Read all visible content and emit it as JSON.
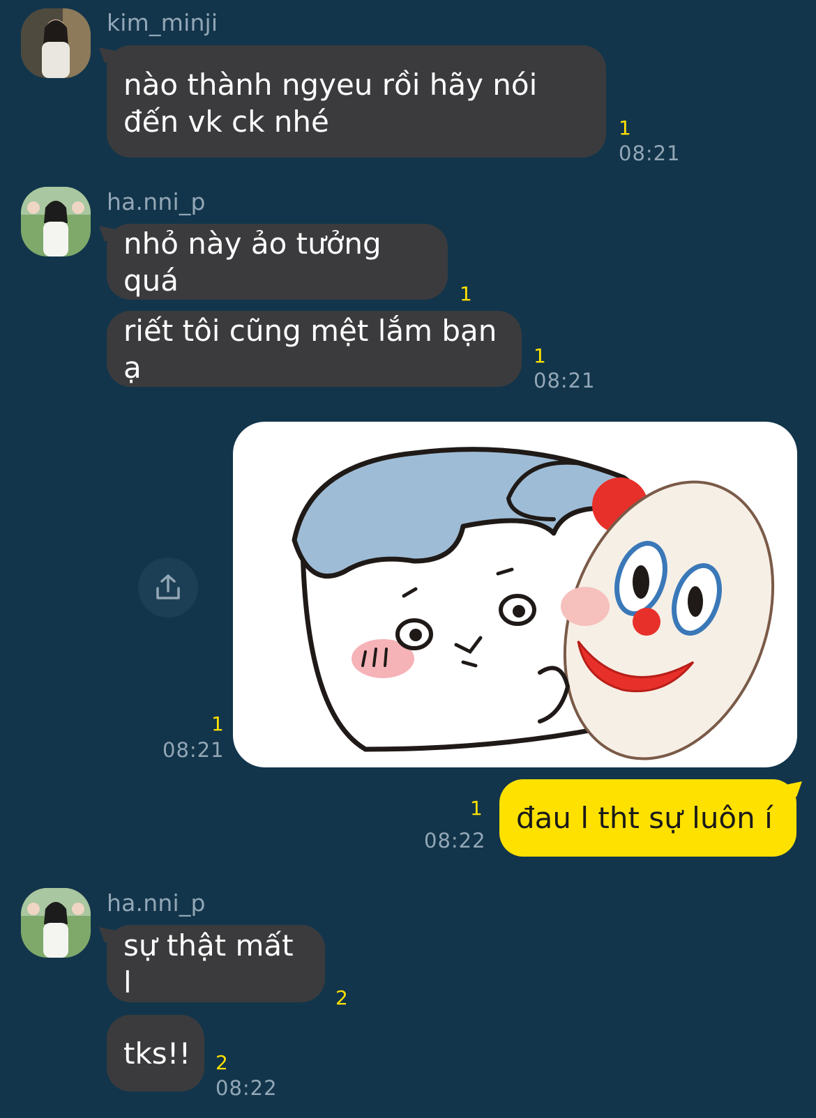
{
  "messages": [
    {
      "sender": "kim_minji",
      "text": "nào thành ngyeu rồi hãy nói đến vk ck nhé",
      "unread": "1",
      "time": "08:21"
    },
    {
      "sender": "ha.nni_p",
      "text": "nhỏ này ảo tưởng quá",
      "unread": "1"
    },
    {
      "text": "riết tôi cũng mệt lắm bạn ạ",
      "unread": "1",
      "time": "08:21"
    },
    {
      "type": "sticker",
      "from": "me",
      "unread": "1",
      "time": "08:21",
      "icon": "share-icon"
    },
    {
      "from": "me",
      "text": "đau l tht sự luôn í",
      "unread": "1",
      "time": "08:22"
    },
    {
      "sender": "ha.nni_p",
      "text": "sự thật mất l",
      "unread": "2"
    },
    {
      "text": "tks!!",
      "unread": "2",
      "time": "08:22"
    }
  ],
  "colors": {
    "background": "#12354b",
    "incoming_bubble": "#3b3b3d",
    "outgoing_bubble": "#ffe100",
    "unread_count": "#ffe100",
    "timestamp": "#93a7b6"
  }
}
